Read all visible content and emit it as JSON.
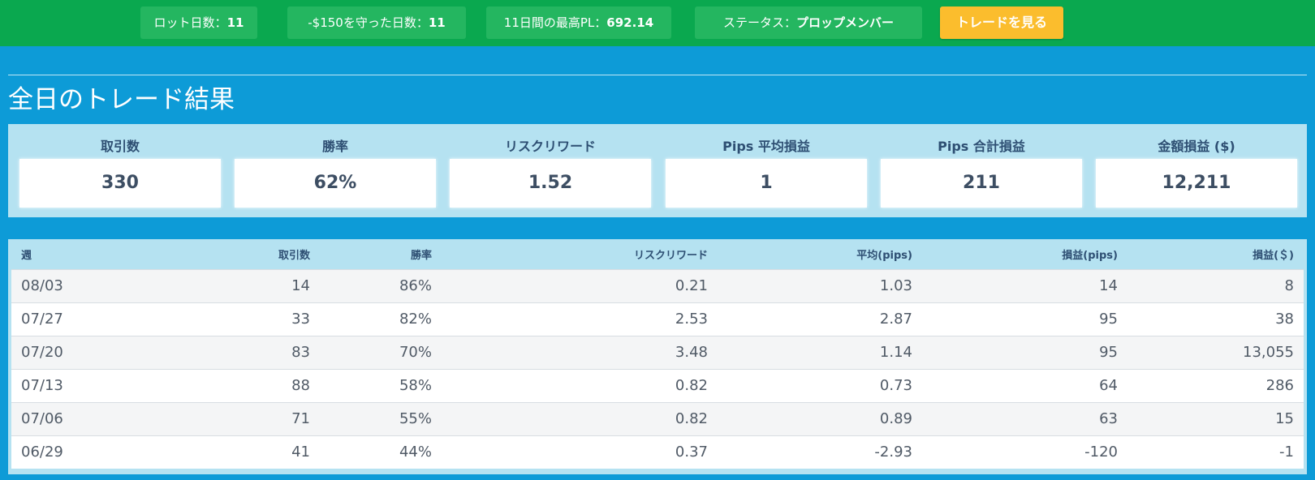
{
  "topbar": {
    "chips": [
      {
        "label": "ロット日数：",
        "value": "11"
      },
      {
        "label": "-$150を守った日数：",
        "value": "11"
      },
      {
        "label": "11日間の最高PL：",
        "value": "692.14"
      },
      {
        "label": "ステータス：",
        "value": "プロップメンバー"
      }
    ],
    "button_label": "トレードを見る"
  },
  "section": {
    "title": "全日のトレード結果"
  },
  "kpis": [
    {
      "label": "取引数",
      "value": "330"
    },
    {
      "label": "勝率",
      "value": "62%"
    },
    {
      "label": "リスクリワード",
      "value": "1.52"
    },
    {
      "label": "Pips 平均損益",
      "value": "1"
    },
    {
      "label": "Pips 合計損益",
      "value": "211"
    },
    {
      "label": "金額損益 ($)",
      "value": "12,211"
    }
  ],
  "weekly_table": {
    "headers": [
      "週",
      "取引数",
      "勝率",
      "リスクリワード",
      "平均(pips)",
      "損益(pips)",
      "損益(＄)"
    ],
    "rows": [
      [
        "08/03",
        "14",
        "86%",
        "0.21",
        "1.03",
        "14",
        "8"
      ],
      [
        "07/27",
        "33",
        "82%",
        "2.53",
        "2.87",
        "95",
        "38"
      ],
      [
        "07/20",
        "83",
        "70%",
        "3.48",
        "1.14",
        "95",
        "13,055"
      ],
      [
        "07/13",
        "88",
        "58%",
        "0.82",
        "0.73",
        "64",
        "286"
      ],
      [
        "07/06",
        "71",
        "55%",
        "0.82",
        "0.89",
        "63",
        "15"
      ],
      [
        "06/29",
        "41",
        "44%",
        "0.37",
        "-2.93",
        "-120",
        "-1"
      ]
    ]
  },
  "colors": {
    "topbar": "#0aa84f",
    "chip": "#24b660",
    "button": "#fbbd2d",
    "page": "#0d9bd7",
    "panel": "#b5e2f1",
    "label_text": "#2e4f73"
  }
}
